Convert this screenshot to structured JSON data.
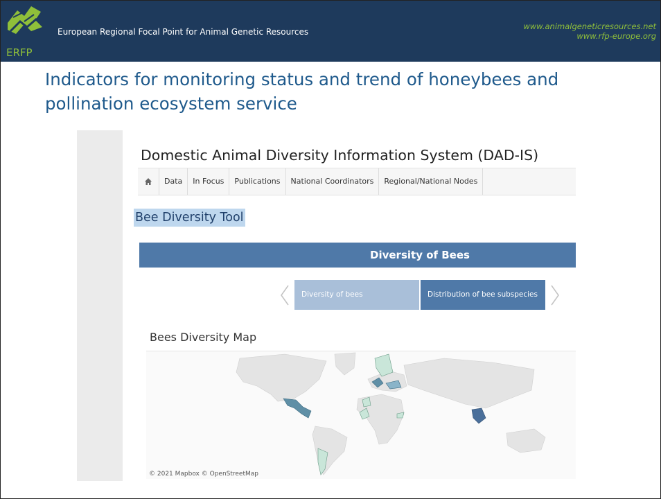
{
  "header": {
    "logo_text": "ERFP",
    "title": "European Regional Focal Point for Animal Genetic Resources",
    "link1": "www.animalgeneticresources.net",
    "link2": "www.rfp-europe.org",
    "colors": {
      "bar": "#1e3a5c",
      "link": "#8fbf3a"
    }
  },
  "slide": {
    "title": "Indicators for monitoring status and trend of honeybees and pollination ecosystem service"
  },
  "screenshot": {
    "site_title": "Domestic Animal Diversity Information System (DAD-IS)",
    "nav": {
      "home_icon": "home-icon",
      "items": [
        "Data",
        "In Focus",
        "Publications",
        "National Coordinators",
        "Regional/National Nodes"
      ]
    },
    "page_heading": "Bee Diversity Tool",
    "banner": "Diversity of Bees",
    "tabs": [
      {
        "label": "Diversity of bees",
        "selected": false
      },
      {
        "label": "Distribution of bee subspecies",
        "selected": true
      }
    ],
    "prev_icon": "chevron-left-icon",
    "next_icon": "chevron-right-icon",
    "map_heading": "Bees Diversity Map",
    "map_credit": "© 2021 Mapbox © OpenStreetMap"
  }
}
